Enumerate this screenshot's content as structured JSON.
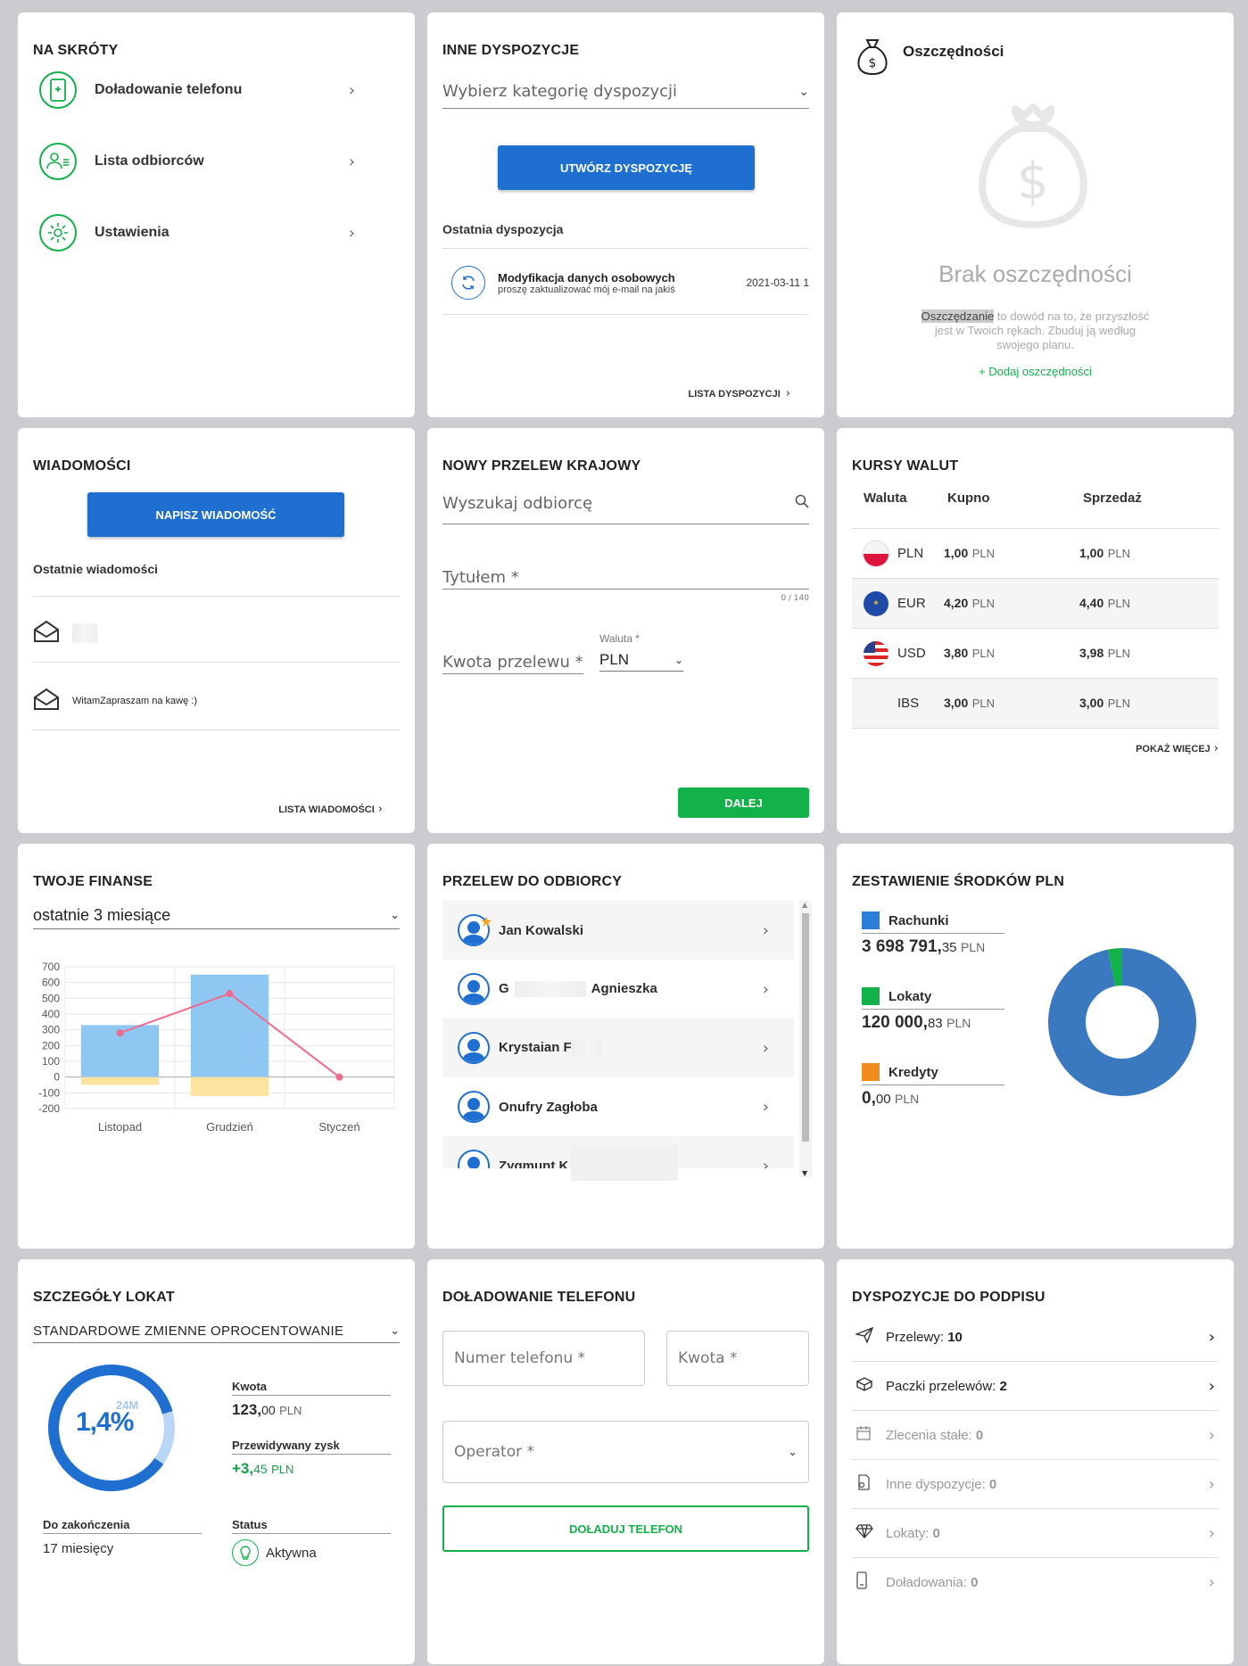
{
  "shortcuts": {
    "title": "NA SKRÓTY",
    "items": [
      {
        "label": "Doładowanie telefonu",
        "icon": "phone-plus-icon"
      },
      {
        "label": "Lista odbiorców",
        "icon": "people-list-icon"
      },
      {
        "label": "Ustawienia",
        "icon": "gear-icon"
      }
    ]
  },
  "other_orders": {
    "title": "INNE DYSPOZYCJE",
    "select_placeholder": "Wybierz kategorię dyspozycji",
    "create_button": "UTWÓRZ DYSPOZYCJĘ",
    "last_heading": "Ostatnia dyspozycja",
    "last_item": {
      "title": "Modyfikacja danych osobowych",
      "desc": "proszę zaktualizować mój e-mail na jakiś",
      "date": "2021-03-11 1"
    },
    "list_link": "LISTA DYSPOZYCJI"
  },
  "savings": {
    "title": "Oszczędności",
    "empty_title": "Brak oszczędności",
    "empty_highlight": "Oszczędzanie",
    "empty_desc_1": " to dowód na to, że przyszłość",
    "empty_desc_2": "jest w Twoich rękach. Zbuduj ją według",
    "empty_desc_3": "swojego planu.",
    "add_link": "+ Dodaj oszczędności"
  },
  "messages": {
    "title": "WIADOMOŚCI",
    "write_button": "NAPISZ WIADOMOŚĆ",
    "recent_heading": "Ostatnie wiadomości",
    "items": [
      {
        "text": ""
      },
      {
        "text": "WitamZapraszam na kawę :)"
      }
    ],
    "list_link": "LISTA WIADOMOŚCI"
  },
  "transfer": {
    "title": "NOWY PRZELEW KRAJOWY",
    "search_placeholder": "Wyszukaj odbiorcę",
    "title_placeholder": "Tytułem *",
    "title_counter": "0 / 140",
    "amount_placeholder": "Kwota przelewu *",
    "currency_label": "Waluta *",
    "currency_value": "PLN",
    "next_button": "DALEJ"
  },
  "rates": {
    "title": "KURSY WALUT",
    "headers": [
      "Waluta",
      "Kupno",
      "Sprzedaż"
    ],
    "rows": [
      {
        "code": "PLN",
        "buy_int": "1,00",
        "buy_unit": "PLN",
        "sell_int": "1,00",
        "sell_unit": "PLN"
      },
      {
        "code": "EUR",
        "buy_int": "4,20",
        "buy_unit": "PLN",
        "sell_int": "4,40",
        "sell_unit": "PLN"
      },
      {
        "code": "USD",
        "buy_int": "3,80",
        "buy_unit": "PLN",
        "sell_int": "3,98",
        "sell_unit": "PLN"
      },
      {
        "code": "IBS",
        "buy_int": "3,00",
        "buy_unit": "PLN",
        "sell_int": "3,00",
        "sell_unit": "PLN"
      }
    ],
    "more_link": "POKAŻ WIĘCEJ"
  },
  "finances": {
    "title": "TWOJE FINANSE",
    "period": "ostatnie 3 miesiące"
  },
  "chart_data": {
    "type": "bar",
    "categories": [
      "Listopad",
      "Grudzień",
      "Styczeń"
    ],
    "series": [
      {
        "name": "",
        "kind": "bar",
        "values": [
          330,
          650,
          0
        ],
        "color": "#8ec8f2"
      },
      {
        "name": "",
        "kind": "bar",
        "values": [
          -50,
          -120,
          0
        ],
        "color": "#fce3a0"
      },
      {
        "name": "",
        "kind": "line",
        "values": [
          280,
          530,
          0
        ],
        "color": "#ef6a8d"
      }
    ],
    "ylim": [
      -200,
      700
    ],
    "yticks": [
      700,
      600,
      500,
      400,
      300,
      200,
      100,
      0,
      -100,
      -200
    ],
    "grid": true,
    "title": "",
    "xlabel": "",
    "ylabel": ""
  },
  "recipients": {
    "title": "PRZELEW DO ODBIORCY",
    "items": [
      {
        "name": "Jan Kowalski"
      },
      {
        "name": "G",
        "name2": "Agnieszka"
      },
      {
        "name": "Krystaian F"
      },
      {
        "name": "Onufry Zagłoba"
      },
      {
        "name": "Zygmunt K"
      }
    ]
  },
  "funds": {
    "title": "ZESTAWIENIE ŚRODKÓW PLN",
    "items": [
      {
        "label": "Rachunki",
        "int": "3 698 791,",
        "dec": "35",
        "unit": "PLN",
        "color": "#2b7fd8"
      },
      {
        "label": "Lokaty",
        "int": "120 000,",
        "dec": "83",
        "unit": "PLN",
        "color": "#13b14a"
      },
      {
        "label": "Kredyty",
        "int": "0,",
        "dec": "00",
        "unit": "PLN",
        "color": "#f08c1e"
      }
    ],
    "donut": [
      {
        "value": 3698791.35,
        "color": "#3a79c0"
      },
      {
        "value": 120000.83,
        "color": "#13b14a"
      }
    ]
  },
  "deposits": {
    "title": "SZCZEGÓŁY LOKAT",
    "type": "STANDARDOWE ZMIENNE OPROCENTOWANIE",
    "term": "24M",
    "rate": "1,4%",
    "progress": 0.86,
    "amount_label": "Kwota",
    "amount_int": "123,",
    "amount_dec": "00",
    "amount_unit": "PLN",
    "profit_label": "Przewidywany zysk",
    "profit_int": "+3,",
    "profit_dec": "45",
    "profit_unit": "PLN",
    "end_label": "Do zakończenia",
    "end_value": "17 miesięcy",
    "status_label": "Status",
    "status_value": "Aktywna"
  },
  "topup": {
    "title": "DOŁADOWANIE TELEFONU",
    "phone_placeholder": "Numer telefonu *",
    "amount_placeholder": "Kwota *",
    "operator_placeholder": "Operator *",
    "button": "DOŁADUJ TELEFON"
  },
  "to_sign": {
    "title": "DYSPOZYCJE DO PODPISU",
    "items": [
      {
        "label": "Przelewy: ",
        "count": "10",
        "icon": "paper-plane-icon",
        "active": true
      },
      {
        "label": "Paczki przelewów: ",
        "count": "2",
        "icon": "package-icon",
        "active": true
      },
      {
        "label": "Zlecenia stałe: ",
        "count": "0",
        "icon": "calendar-icon",
        "active": false
      },
      {
        "label": "Inne dyspozycje: ",
        "count": "0",
        "icon": "document-icon",
        "active": false
      },
      {
        "label": "Lokaty: ",
        "count": "0",
        "icon": "diamond-icon",
        "active": false
      },
      {
        "label": "Doładowania: ",
        "count": "0",
        "icon": "phone-icon",
        "active": false
      }
    ]
  }
}
